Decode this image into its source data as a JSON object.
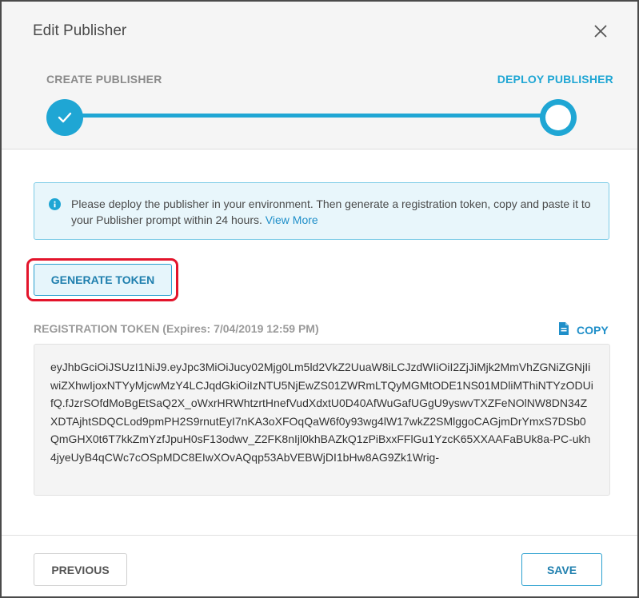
{
  "dialog": {
    "title": "Edit Publisher"
  },
  "stepper": {
    "steps": [
      {
        "label": "CREATE PUBLISHER",
        "state": "completed"
      },
      {
        "label": "DEPLOY PUBLISHER",
        "state": "current"
      }
    ],
    "accent_color": "#1fa6d4"
  },
  "info": {
    "message": "Please deploy the publisher in your environment. Then generate a registration token, copy and paste it to your Publisher prompt within 24 hours.",
    "link_text": "View More",
    "icon": "info-icon"
  },
  "actions": {
    "generate_label": "GENERATE TOKEN",
    "highlight_color": "#e3142b"
  },
  "token": {
    "label": "REGISTRATION TOKEN",
    "expires": "(Expires: 7/04/2019 12:59 PM)",
    "copy_label": "COPY",
    "copy_icon": "document-icon",
    "value": "eyJhbGciOiJSUzI1NiJ9.eyJpc3MiOiJucy02Mjg0Lm5ld2VkZ2UuaW8iLCJzdWIiOiI2ZjJiMjk2MmVhZGNiZGNjIiwiZXhwIjoxNTYyMjcwMzY4LCJqdGkiOiIzNTU5NjEwZS01ZWRmLTQyMGMtODE1NS01MDliMThiNTYzODUifQ.fJzrSOfdMoBgEtSaQ2X_oWxrHRWhtzrtHnefVudXdxtU0D40AfWuGafUGgU9yswvTXZFeNOlNW8DN34ZXDTAjhtSDQCLod9pmPH2S9rnutEyI7nKA3oXFOqQaW6f0y93wg4lW17wkZ2SMlggoCAGjmDrYmxS7DSb0QmGHX0t6T7kkZmYzfJpuH0sF13odwv_Z2FK8nIjl0khBAZkQ1zPiBxxFFlGu1YzcK65XXAAFaBUk8a-PC-ukh4jyeUyB4qCWc7cOSpMDC8EIwXOvAQqp53AbVEBWjDI1bHw8AG9Zk1Wrig-"
  },
  "footer": {
    "previous_label": "PREVIOUS",
    "save_label": "SAVE"
  }
}
